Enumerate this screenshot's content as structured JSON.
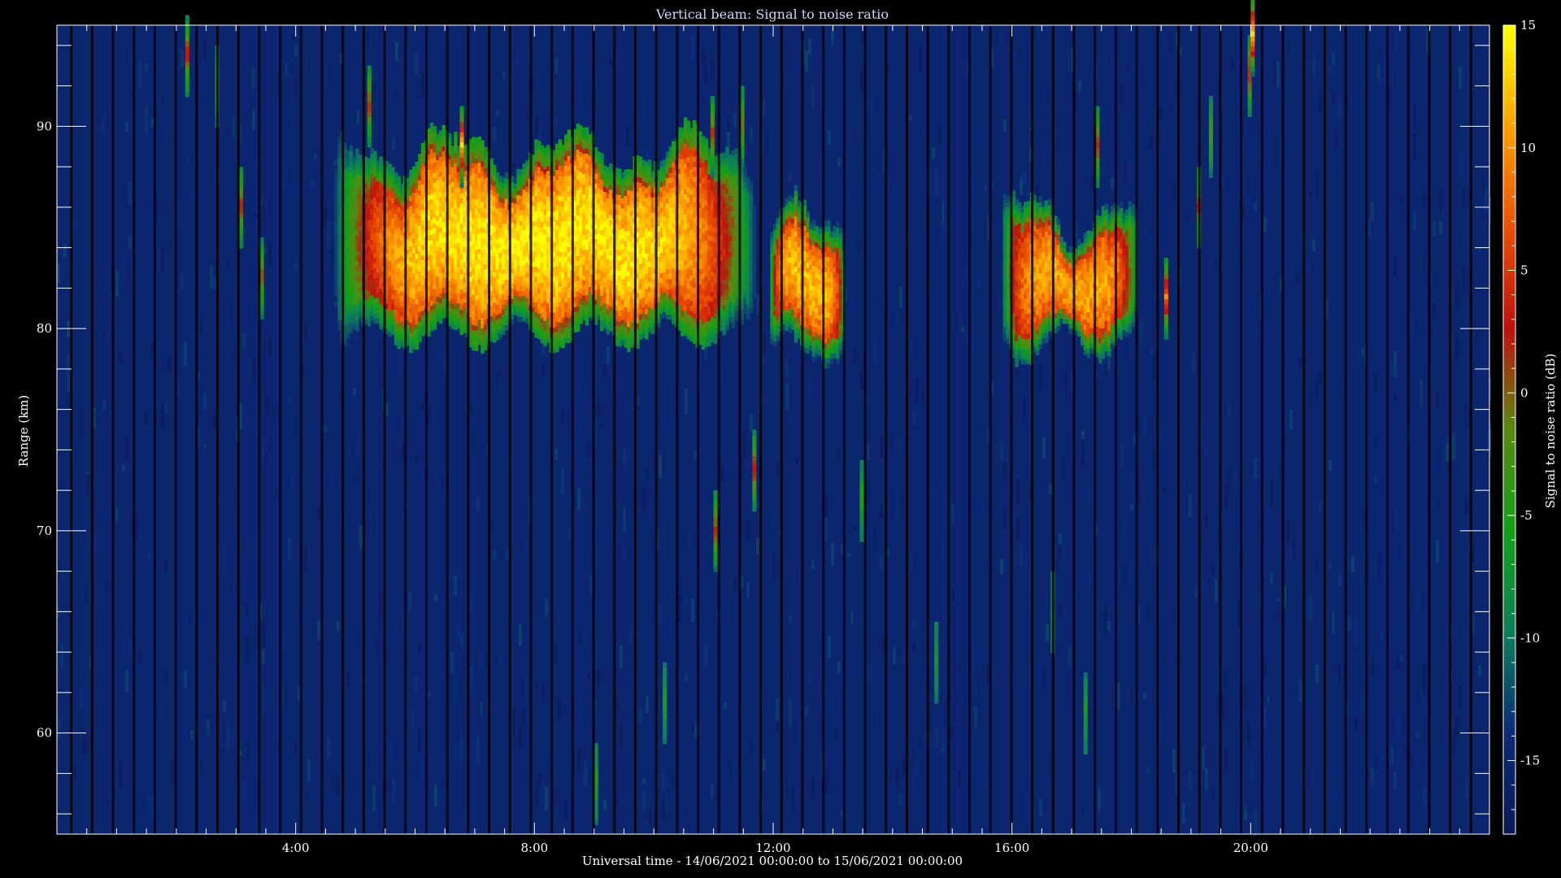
{
  "chart_data": {
    "type": "heatmap",
    "title": "Vertical beam: Signal to noise ratio",
    "xlabel": "Universal time - 14/06/2021 00:00:00 to 15/06/2021 00:00:00",
    "ylabel": "Range (km)",
    "colorbar_label": "Signal to noise ratio (dB)",
    "x_unit": "hours UT",
    "xlim": [
      0,
      24
    ],
    "ylim": [
      55,
      95
    ],
    "clim": [
      -18,
      15
    ],
    "x_ticks": [
      {
        "value": 4,
        "label": "4:00"
      },
      {
        "value": 8,
        "label": "8:00"
      },
      {
        "value": 12,
        "label": "12:00"
      },
      {
        "value": 16,
        "label": "16:00"
      },
      {
        "value": 20,
        "label": "20:00"
      }
    ],
    "y_ticks": [
      {
        "value": 60,
        "label": "60"
      },
      {
        "value": 70,
        "label": "70"
      },
      {
        "value": 80,
        "label": "80"
      },
      {
        "value": 90,
        "label": "90"
      }
    ],
    "colorbar_ticks": [
      {
        "value": 15,
        "label": "15"
      },
      {
        "value": 10,
        "label": "10"
      },
      {
        "value": 5,
        "label": "5"
      },
      {
        "value": 0,
        "label": "0"
      },
      {
        "value": -5,
        "label": "-5"
      },
      {
        "value": -10,
        "label": "-10"
      },
      {
        "value": -15,
        "label": "-15"
      }
    ],
    "colormap": [
      "#0a1a55",
      "#0c2a78",
      "#0c7f5a",
      "#12a018",
      "#5a8a10",
      "#c01010",
      "#e85000",
      "#ffa000",
      "#ffff00"
    ],
    "background_value": -15,
    "data_gap_interval_hours": 0.35,
    "echo_regions": [
      {
        "t_start": 4.6,
        "t_end": 11.7,
        "range_low": 80.3,
        "range_high": 88.5,
        "peak_snr": 14
      },
      {
        "t_start": 11.9,
        "t_end": 13.2,
        "range_low": 79.5,
        "range_high": 85.0,
        "peak_snr": 12
      },
      {
        "t_start": 15.8,
        "t_end": 18.1,
        "range_low": 79.6,
        "range_high": 85.5,
        "peak_snr": 11
      }
    ],
    "isolated_echoes": [
      {
        "t": 2.15,
        "r": 93.5,
        "snr": 3
      },
      {
        "t": 2.65,
        "r": 92.0,
        "snr": -4
      },
      {
        "t": 3.05,
        "r": 86.0,
        "snr": 2
      },
      {
        "t": 3.4,
        "r": 82.5,
        "snr": 1
      },
      {
        "t": 5.2,
        "r": 91.0,
        "snr": 2
      },
      {
        "t": 6.75,
        "r": 89.0,
        "snr": 13
      },
      {
        "t": 10.95,
        "r": 89.5,
        "snr": 2
      },
      {
        "t": 11.45,
        "r": 90.0,
        "snr": 0
      },
      {
        "t": 11.65,
        "r": 73.0,
        "snr": 3
      },
      {
        "t": 11.0,
        "r": 70.0,
        "snr": 2
      },
      {
        "t": 13.45,
        "r": 71.5,
        "snr": -5
      },
      {
        "t": 17.4,
        "r": 89.0,
        "snr": 2
      },
      {
        "t": 18.55,
        "r": 81.5,
        "snr": 9
      },
      {
        "t": 19.1,
        "r": 86.0,
        "snr": 2
      },
      {
        "t": 19.95,
        "r": 92.5,
        "snr": 4
      },
      {
        "t": 20.0,
        "r": 94.5,
        "snr": 14
      },
      {
        "t": 19.3,
        "r": 89.5,
        "snr": -3
      },
      {
        "t": 9.0,
        "r": 57.5,
        "snr": -5
      },
      {
        "t": 10.15,
        "r": 61.5,
        "snr": -5
      },
      {
        "t": 17.2,
        "r": 61.0,
        "snr": -6
      },
      {
        "t": 16.65,
        "r": 66.0,
        "snr": -7
      },
      {
        "t": 14.7,
        "r": 63.5,
        "snr": -7
      }
    ]
  }
}
